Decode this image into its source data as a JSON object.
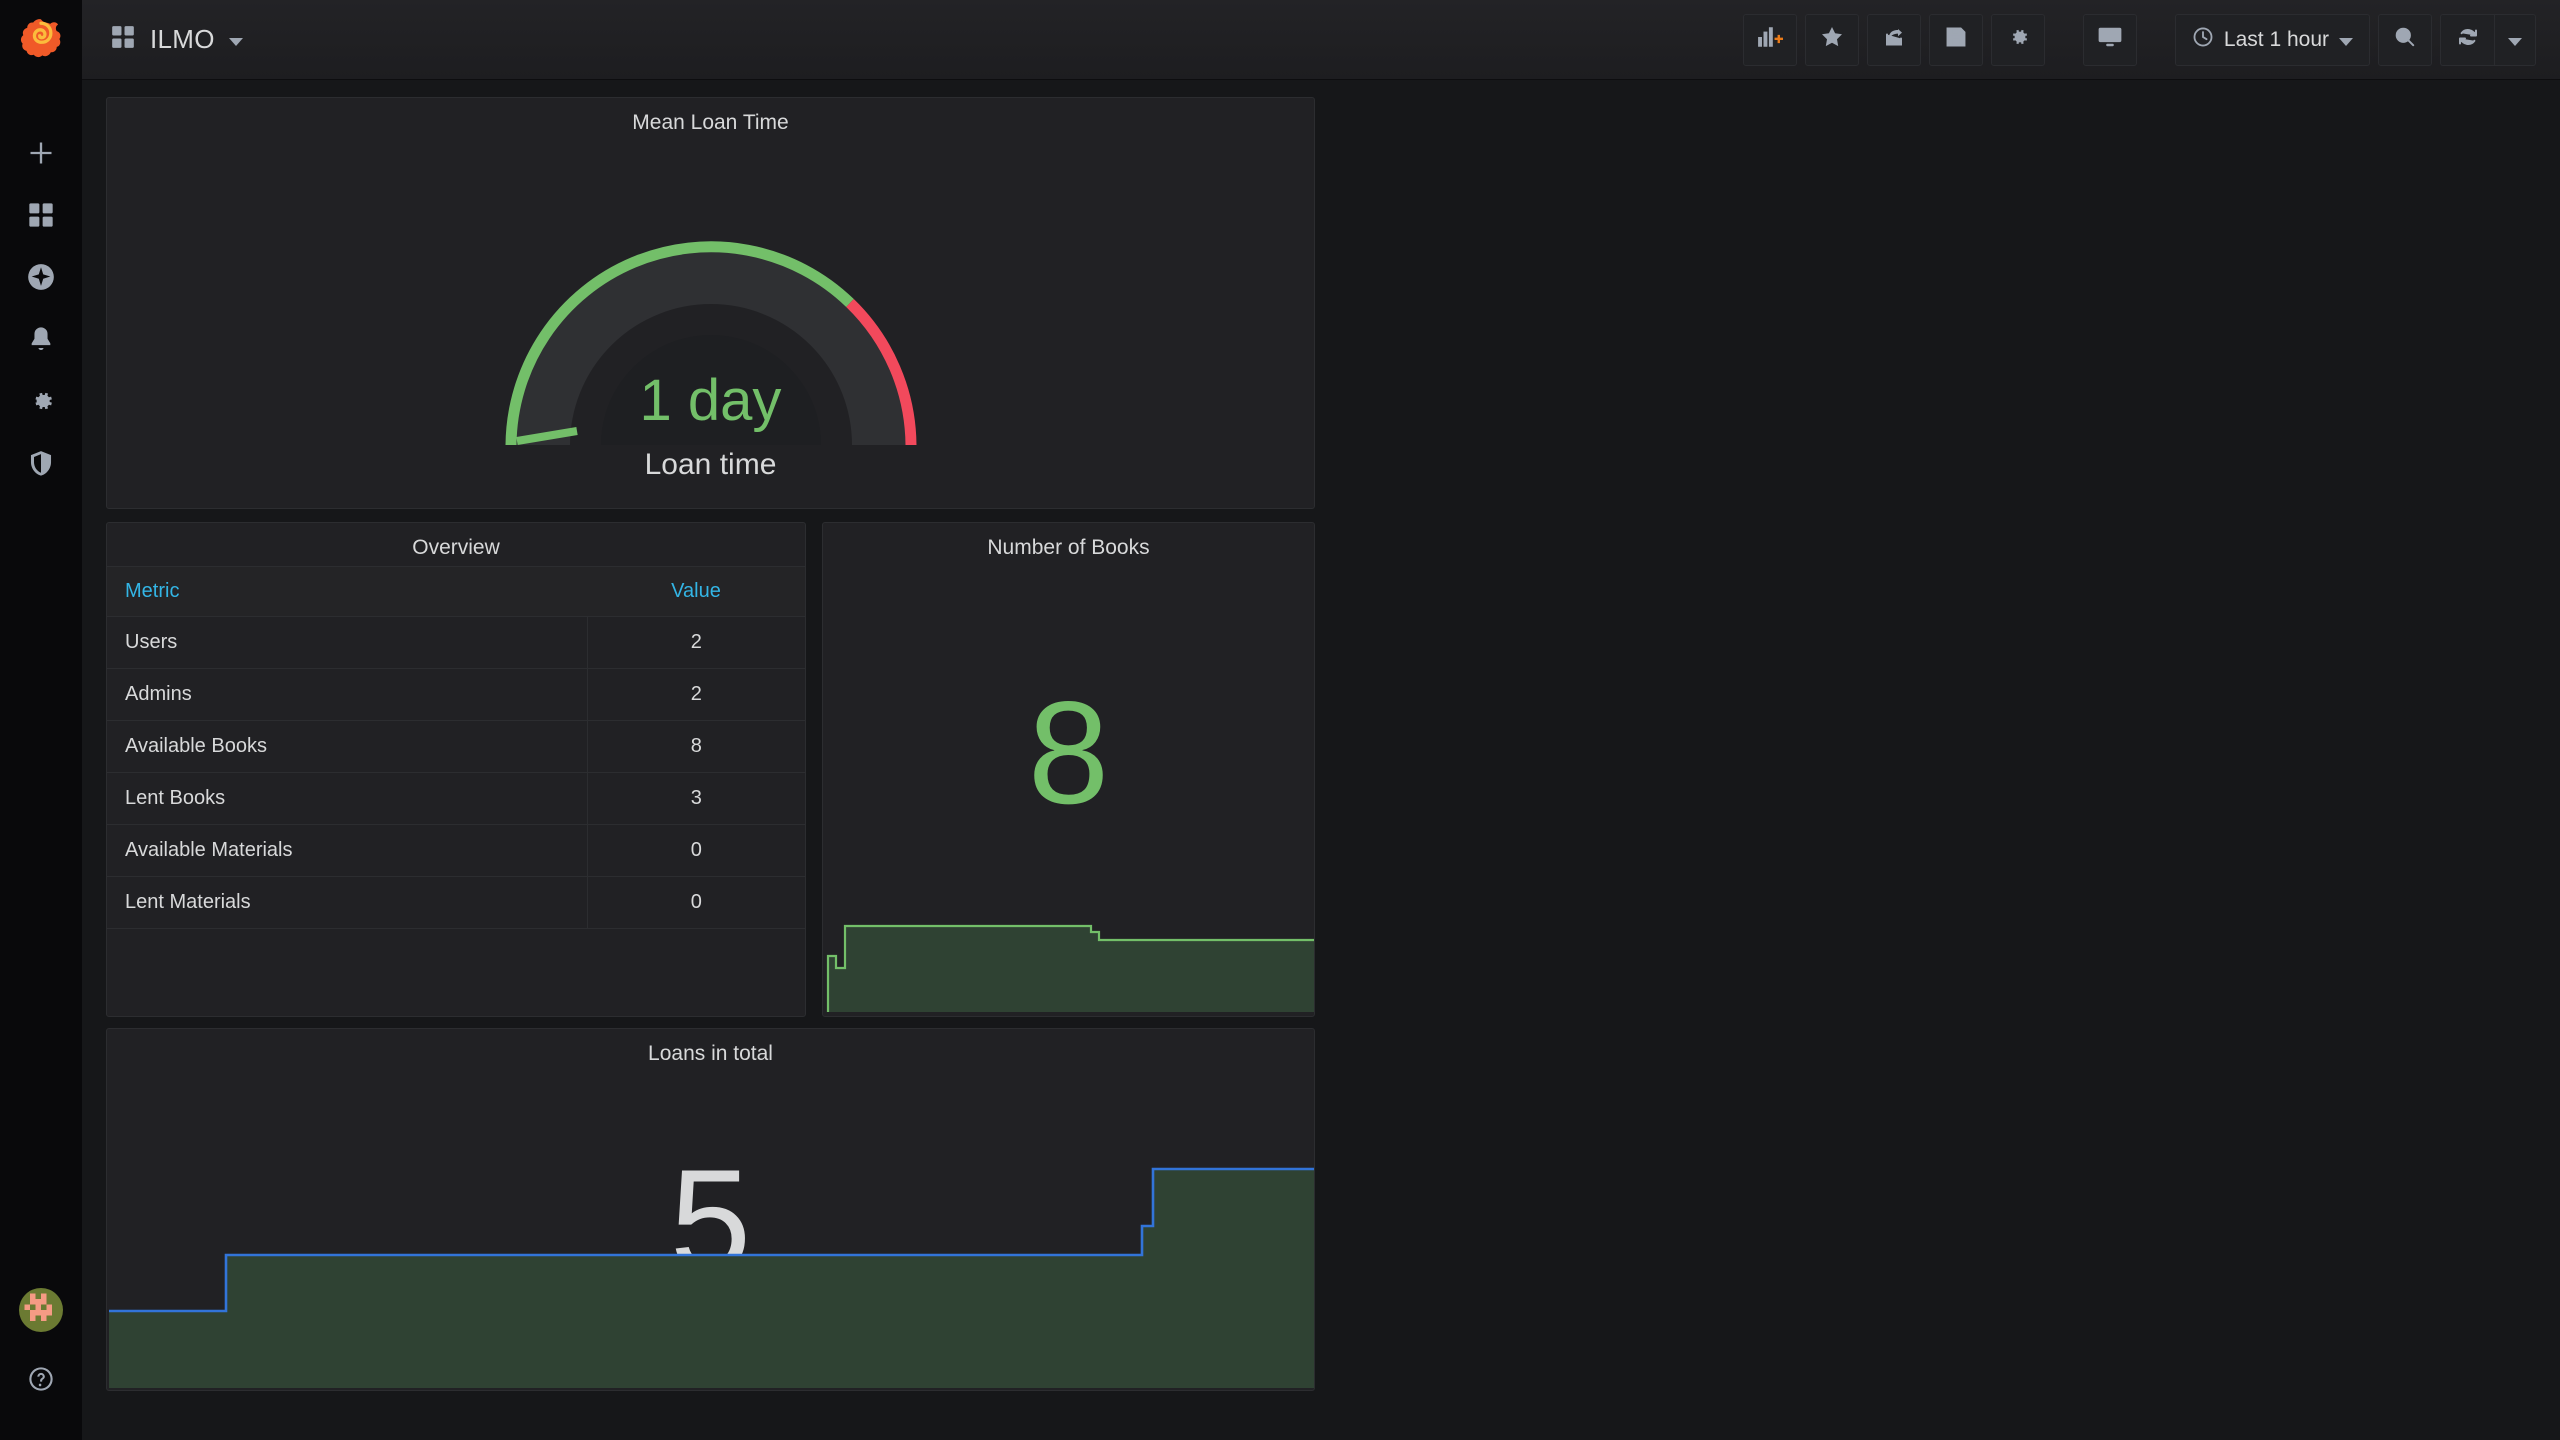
{
  "app": {
    "brand_icon": "grafana-logo-icon",
    "background_color": "#161719",
    "panel_color": "#212124",
    "accent_green": "#73bf69",
    "accent_red": "#f2495c",
    "accent_blue": "#33b5e5",
    "line_blue": "#3274d9",
    "fill_green": "#2f4233"
  },
  "sidebar": {
    "top_items": [
      {
        "name": "create",
        "icon": "plus-icon"
      },
      {
        "name": "dashboards",
        "icon": "dashboards-icon"
      },
      {
        "name": "explore",
        "icon": "compass-icon"
      },
      {
        "name": "alerting",
        "icon": "bell-icon"
      },
      {
        "name": "configuration",
        "icon": "gear-icon"
      },
      {
        "name": "server-admin",
        "icon": "shield-icon"
      }
    ],
    "bottom_items": [
      {
        "name": "user-profile",
        "icon": "avatar-icon"
      },
      {
        "name": "help",
        "icon": "question-circle-icon"
      }
    ]
  },
  "topbar": {
    "dashboard_icon": "dashboards-icon",
    "dashboard_title": "ILMO",
    "actions": [
      {
        "name": "add-panel",
        "icon": "add-panel-icon"
      },
      {
        "name": "mark-favorite",
        "icon": "star-icon"
      },
      {
        "name": "share-dashboard",
        "icon": "share-icon"
      },
      {
        "name": "save-dashboard",
        "icon": "save-icon"
      },
      {
        "name": "dashboard-settings",
        "icon": "gear-icon"
      },
      {
        "name": "cycle-view-mode",
        "icon": "monitor-icon"
      }
    ],
    "time_range": {
      "icon": "clock-icon",
      "label": "Last 1 hour"
    },
    "zoom_out": {
      "name": "zoom-out",
      "icon": "search-minus-icon"
    },
    "refresh": {
      "name": "refresh",
      "icon": "refresh-icon"
    },
    "refresh_interval": {
      "name": "refresh-interval",
      "icon": "chevron-down-icon"
    }
  },
  "panels": {
    "gauge": {
      "title": "Mean Loan Time",
      "value": "1 day",
      "label": "Loan time"
    },
    "overview": {
      "title": "Overview",
      "columns": [
        "Metric",
        "Value"
      ],
      "rows": [
        {
          "metric": "Users",
          "value": "2"
        },
        {
          "metric": "Admins",
          "value": "2"
        },
        {
          "metric": "Available Books",
          "value": "8"
        },
        {
          "metric": "Lent Books",
          "value": "3"
        },
        {
          "metric": "Available Materials",
          "value": "0"
        },
        {
          "metric": "Lent Materials",
          "value": "0"
        }
      ]
    },
    "books": {
      "title": "Number of Books",
      "value": "8"
    },
    "loans": {
      "title": "Loans in total",
      "value": "5"
    }
  },
  "chart_data": [
    {
      "type": "gauge",
      "title": "Mean Loan Time",
      "value": 1,
      "value_display": "1 day",
      "unit": "days",
      "label": "Loan time",
      "min": 0,
      "max": 1.1,
      "thresholds": [
        {
          "from": 0,
          "to": 0.91,
          "color": "#73bf69"
        },
        {
          "from": 0.91,
          "to": 1.1,
          "color": "#f2495c"
        }
      ]
    },
    {
      "type": "table",
      "title": "Overview",
      "columns": [
        "Metric",
        "Value"
      ],
      "rows": [
        [
          "Users",
          2
        ],
        [
          "Admins",
          2
        ],
        [
          "Available Books",
          8
        ],
        [
          "Lent Books",
          3
        ],
        [
          "Available Materials",
          0
        ],
        [
          "Lent Materials",
          0
        ]
      ]
    },
    {
      "type": "area",
      "title": "Number of Books",
      "big_value": 8,
      "ylim": [
        0,
        9
      ],
      "line_color": "#73bf69",
      "fill_color": "#2f4233",
      "x": [
        0,
        1,
        2,
        3,
        4,
        5,
        40,
        41,
        42,
        50
      ],
      "values": [
        0,
        7,
        7,
        6,
        6,
        8,
        8,
        7.4,
        7,
        7
      ]
    },
    {
      "type": "area",
      "title": "Loans in total",
      "big_value": 5,
      "ylim": [
        0,
        6
      ],
      "line_color": "#3274d9",
      "fill_color": "#2f4233",
      "x": [
        0,
        6,
        6,
        51,
        51,
        53,
        53,
        100
      ],
      "values": [
        3,
        3,
        4,
        4,
        4.4,
        4.4,
        5,
        5
      ]
    }
  ]
}
